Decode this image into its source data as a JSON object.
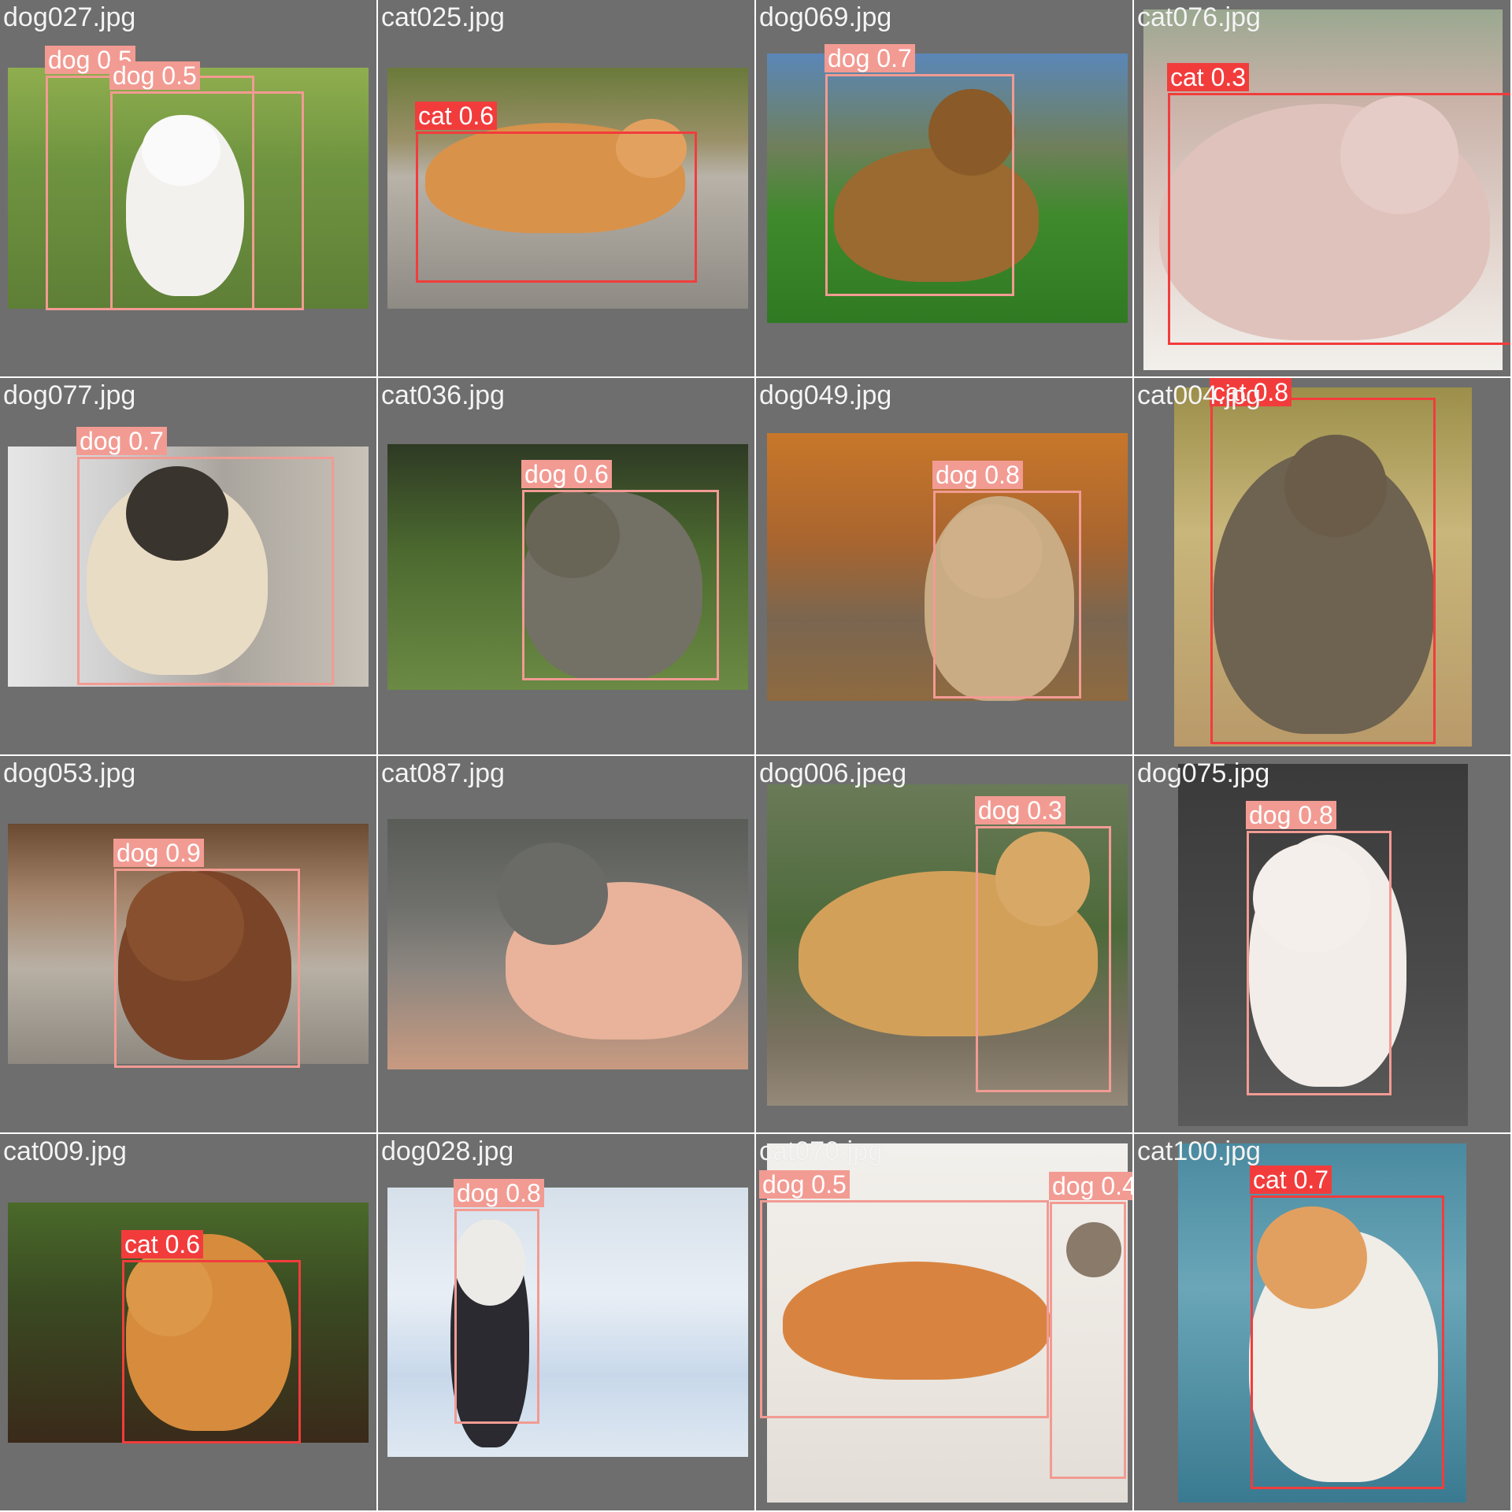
{
  "colors": {
    "tile_background": "#6e6e6e",
    "dog_box": "#f29b93",
    "cat_box": "#f23c3c",
    "filename_text": "#f4f4f4"
  },
  "tiles": [
    {
      "filename": "dog027.jpg",
      "photo": "white pit bull lying on grass",
      "detections": [
        {
          "label": "dog 0.5",
          "class": "dog"
        },
        {
          "label": "dog 0.5",
          "class": "dog"
        }
      ]
    },
    {
      "filename": "cat025.jpg",
      "photo": "orange tabby cat lying on wooden boards",
      "detections": [
        {
          "label": "cat 0.6",
          "class": "cat"
        }
      ]
    },
    {
      "filename": "dog069.jpg",
      "photo": "german shepherd lying on grass under trees",
      "detections": [
        {
          "label": "dog 0.7",
          "class": "dog"
        }
      ]
    },
    {
      "filename": "cat076.jpg",
      "photo": "hairless sphynx cat by window",
      "detections": [
        {
          "label": "cat 0.3",
          "class": "cat"
        }
      ]
    },
    {
      "filename": "dog077.jpg",
      "photo": "pug sitting by white wall",
      "detections": [
        {
          "label": "dog 0.7",
          "class": "dog"
        }
      ]
    },
    {
      "filename": "cat036.jpg",
      "photo": "grey tabby cat yawning in grass",
      "detections": [
        {
          "label": "dog 0.6",
          "class": "dog"
        }
      ]
    },
    {
      "filename": "dog049.jpg",
      "photo": "labrador with orange collar on autumn path",
      "detections": [
        {
          "label": "dog 0.8",
          "class": "dog"
        }
      ]
    },
    {
      "filename": "cat004.jpg",
      "photo": "tabby cat sitting on post",
      "detections": [
        {
          "label": "cat 0.8",
          "class": "cat"
        }
      ]
    },
    {
      "filename": "dog053.jpg",
      "photo": "brown dog smiling on patio",
      "detections": [
        {
          "label": "dog 0.9",
          "class": "dog"
        }
      ]
    },
    {
      "filename": "cat087.jpg",
      "photo": "cat paw on human hand",
      "detections": []
    },
    {
      "filename": "dog006.jpeg",
      "photo": "dingo standing among plants",
      "detections": [
        {
          "label": "dog 0.3",
          "class": "dog"
        }
      ]
    },
    {
      "filename": "dog075.jpg",
      "photo": "white fluffy dog on dark background",
      "detections": [
        {
          "label": "dog 0.8",
          "class": "dog"
        }
      ]
    },
    {
      "filename": "cat009.jpg",
      "photo": "fluffy orange cat on soil",
      "detections": [
        {
          "label": "cat 0.6",
          "class": "cat"
        }
      ]
    },
    {
      "filename": "dog028.jpg",
      "photo": "husky puppy running in snow",
      "detections": [
        {
          "label": "dog 0.8",
          "class": "dog"
        }
      ]
    },
    {
      "filename": "cat070.jpg",
      "photo": "two cats leaping on white background",
      "detections": [
        {
          "label": "dog 0.5",
          "class": "dog"
        },
        {
          "label": "dog 0.4",
          "class": "dog"
        }
      ]
    },
    {
      "filename": "cat100.jpg",
      "photo": "orange and white cat on blue bokeh",
      "detections": [
        {
          "label": "cat 0.7",
          "class": "cat"
        }
      ]
    }
  ]
}
